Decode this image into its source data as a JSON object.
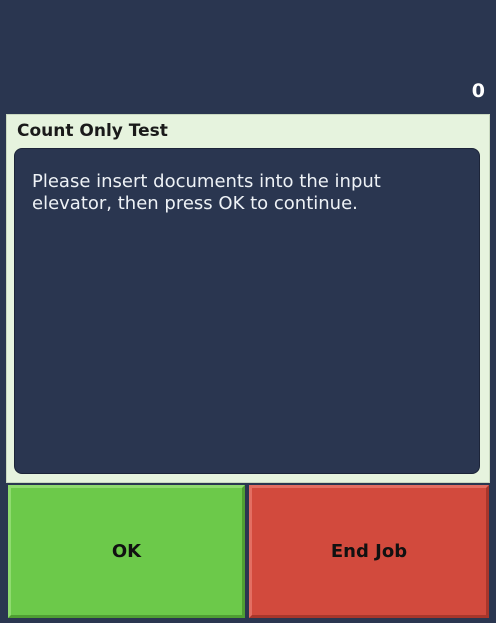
{
  "counter": "0",
  "dialog": {
    "title": "Count Only Test",
    "message": "Please insert documents into the input elevator, then press OK to continue."
  },
  "buttons": {
    "ok_label": "OK",
    "end_job_label": "End Job"
  },
  "colors": {
    "background": "#2a3650",
    "dialog_background": "#e6f3de",
    "ok_button": "#6cc94a",
    "end_job_button": "#d24a3d"
  }
}
